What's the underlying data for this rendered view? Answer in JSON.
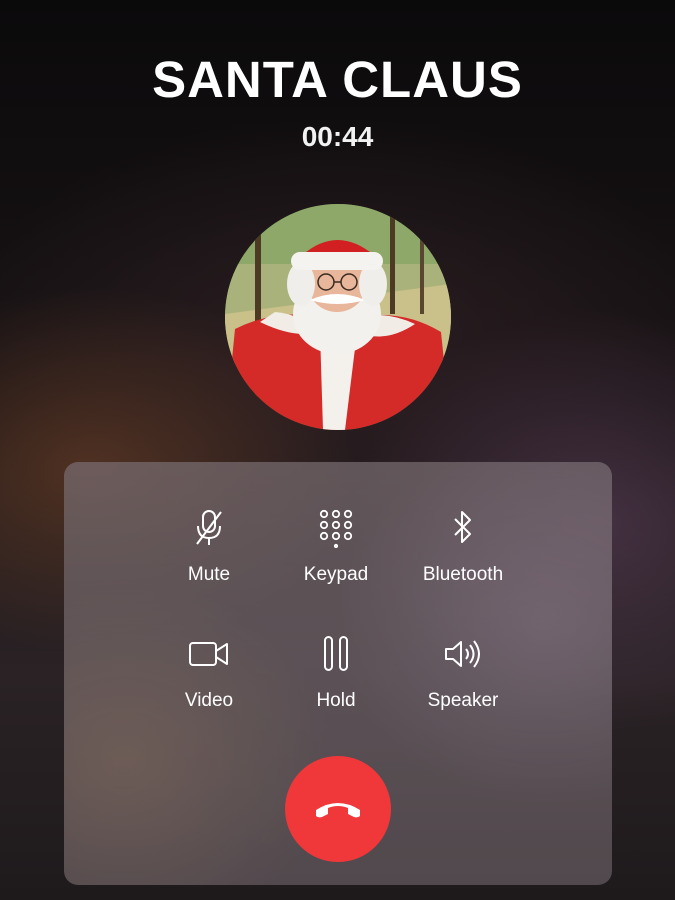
{
  "call": {
    "caller_name": "SANTA CLAUS",
    "duration": "00:44"
  },
  "avatar": {
    "icon": "caller-photo"
  },
  "controls": {
    "mute": {
      "label": "Mute",
      "icon": "mic-off-icon"
    },
    "keypad": {
      "label": "Keypad",
      "icon": "keypad-icon"
    },
    "bluetooth": {
      "label": "Bluetooth",
      "icon": "bluetooth-icon"
    },
    "video": {
      "label": "Video",
      "icon": "video-icon"
    },
    "hold": {
      "label": "Hold",
      "icon": "pause-icon"
    },
    "speaker": {
      "label": "Speaker",
      "icon": "speaker-icon"
    }
  },
  "end_call": {
    "icon": "phone-hangup-icon",
    "color": "#f0383a"
  }
}
